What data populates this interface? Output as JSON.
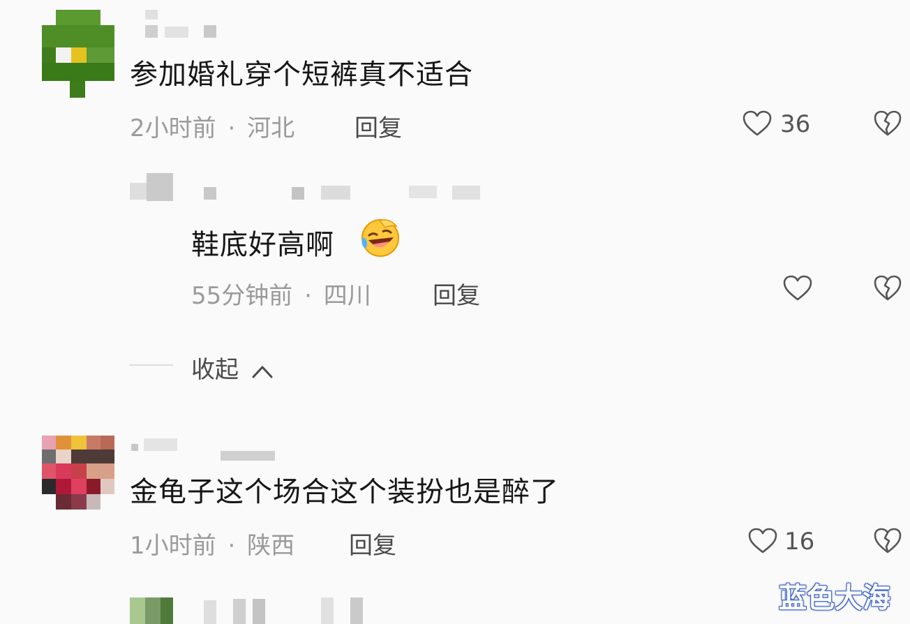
{
  "comments": [
    {
      "text": "参加婚礼穿个短裤真不适合",
      "time": "2小时前",
      "separator": "·",
      "location": "河北",
      "reply_label": "回复",
      "likes": "36",
      "replies": [
        {
          "text": "鞋底好高啊",
          "emoji": "rolling-laughing-emoji",
          "time": "55分钟前",
          "separator": "·",
          "location": "四川",
          "reply_label": "回复"
        }
      ],
      "collapse_label": "收起",
      "collapse_icon": "chevron-up-icon"
    },
    {
      "text": "金龟子这个场合这个装扮也是醉了",
      "time": "1小时前",
      "separator": "·",
      "location": "陕西",
      "reply_label": "回复",
      "likes": "16"
    }
  ],
  "watermark": "蓝色大海",
  "colors": {
    "background": "#fafafa",
    "text": "#161616",
    "meta": "#9a9a9a",
    "watermark_outline": "#3b5ec0"
  }
}
